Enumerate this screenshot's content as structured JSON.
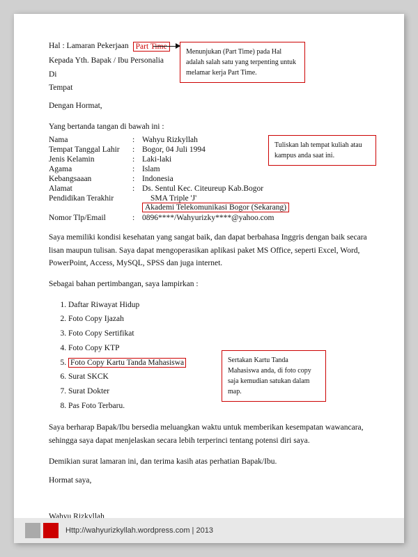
{
  "header": {
    "hal_label": "Hal : Lamaran Pekerjaan",
    "part_time": "Part Time",
    "callout1_text": "Menunjukan (Part Time) pada Hal adalah salah satu yang terpenting untuk melamar kerja Part Time."
  },
  "kepada": {
    "line1": "Kepada Yth. Bapak / Ibu Personalia",
    "line2": "Di",
    "line3": "Tempat",
    "line4": "Dengan Hormat,"
  },
  "yang_bertanda": "Yang bertanda tangan di bawah ini :",
  "info": {
    "rows": [
      {
        "label": "Nama",
        "value": "Wahyu Rizkyllah"
      },
      {
        "label": "Tempat Tanggal Lahir",
        "value": "Bogor, 04 Juli 1994"
      },
      {
        "label": "Jenis Kelamin",
        "value": "Laki-laki"
      },
      {
        "label": "Agama",
        "value": "Islam"
      },
      {
        "label": "Kebangsaaan",
        "value": "Indonesia"
      },
      {
        "label": "Alamat",
        "value": "Ds. Sentul Kec. Citeureup Kab.Bogor"
      },
      {
        "label": "Pendidikan Terakhir",
        "value_sma": "SMA Triple 'J'",
        "value_akademi": "Akademi Telekomunikasi Bogor (Sekarang)"
      },
      {
        "label": "Nomor Tlp/Email",
        "value": ": 0896****/Wahyurizky****@yahoo.com"
      }
    ],
    "callout2_text": "Tuliskan lah tempat kuliah atau kampus anda saat ini."
  },
  "paragraph1": "Saya memiliki kondisi kesehatan yang sangat baik, dan dapat berbahasa Inggris dengan baik secara lisan maupun tulisan. Saya dapat mengoperasikan aplikasi paket MS Office, seperti Excel, Word, PowerPoint, Access, MySQL, SPSS dan juga internet.",
  "sebagai": "Sebagai bahan pertimbangan, saya lampirkan :",
  "list": {
    "items": [
      "Daftar Riwayat Hidup",
      "Foto Copy Ijazah",
      "Foto Copy Sertifikat",
      "Foto Copy KTP",
      "Foto Copy Kartu Tanda Mahasiswa",
      "Surat SKCK",
      "Surat Dokter",
      "Pas Foto Terbaru."
    ],
    "callout3_text": "Sertakan Kartu Tanda Mahasiswa anda, di foto copy saja kemudian satukan dalam map."
  },
  "paragraph2": "Saya berharap Bapak/Ibu bersedia meluangkan waktu untuk memberikan kesempatan wawancara, sehingga saya dapat menjelaskan secara lebih terperinci tentang potensi diri saya.",
  "paragraph3": "Demikian surat lamaran ini, dan terima kasih atas perhatian Bapak/Ibu.",
  "hormat": "Hormat saya,",
  "nama": "Wahyu Rizkyllah",
  "footer": {
    "url": "Http://wahyurizkyllah.wordpress.com | 2013"
  }
}
